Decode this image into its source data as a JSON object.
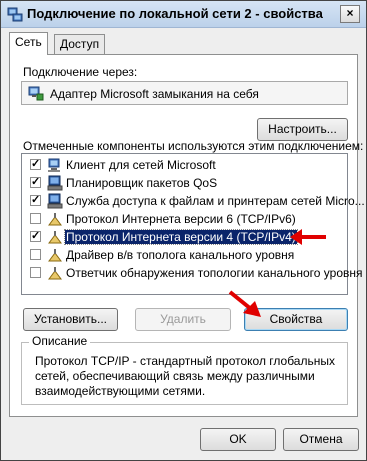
{
  "window": {
    "title": "Подключение по локальной сети 2 - свойства",
    "close_glyph": "×"
  },
  "tabs": [
    {
      "label": "Сеть",
      "active": true
    },
    {
      "label": "Доступ",
      "active": false
    }
  ],
  "connect_using": {
    "label": "Подключение через:",
    "adapter": "Адаптер Microsoft замыкания на себя",
    "configure_button": "Настроить..."
  },
  "components": {
    "label": "Отмеченные компоненты используются этим подключением:",
    "items": [
      {
        "label": "Клиент для сетей Microsoft",
        "checked": true,
        "icon": "network-client-icon",
        "selected": false
      },
      {
        "label": "Планировщик пакетов QoS",
        "checked": true,
        "icon": "service-icon",
        "selected": false
      },
      {
        "label": "Служба доступа к файлам и принтерам сетей Micro...",
        "checked": true,
        "icon": "service-icon",
        "selected": false
      },
      {
        "label": "Протокол Интернета версии 6 (TCP/IPv6)",
        "checked": false,
        "icon": "protocol-icon",
        "selected": false
      },
      {
        "label": "Протокол Интернета версии 4 (TCP/IPv4)",
        "checked": true,
        "icon": "protocol-icon",
        "selected": true
      },
      {
        "label": "Драйвер в/в тополога канального уровня",
        "checked": false,
        "icon": "protocol-icon",
        "selected": false
      },
      {
        "label": "Ответчик обнаружения топологии канального уровня",
        "checked": false,
        "icon": "protocol-icon",
        "selected": false
      }
    ]
  },
  "buttons": {
    "install": "Установить...",
    "remove": "Удалить",
    "properties": "Свойства",
    "ok": "OK",
    "cancel": "Отмена"
  },
  "description": {
    "legend": "Описание",
    "text": "Протокол TCP/IP - стандартный протокол глобальных сетей, обеспечивающий связь между различными взаимодействующими сетями."
  },
  "colors": {
    "selection": "#0a246a",
    "annotation_arrow": "#e00000"
  }
}
